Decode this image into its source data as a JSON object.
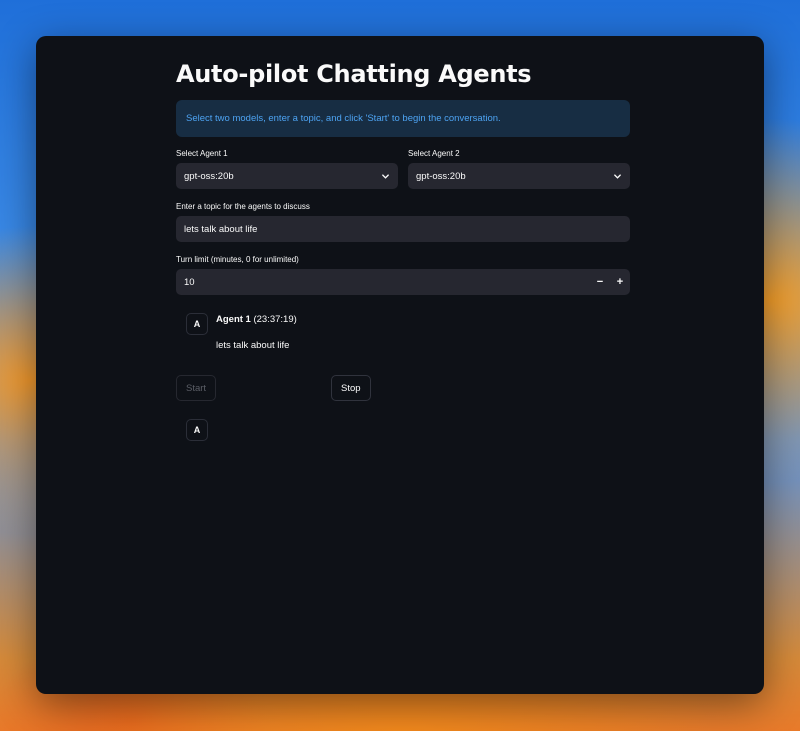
{
  "app": {
    "title": "Auto-pilot Chatting Agents",
    "info": "Select two models, enter a topic, and click 'Start' to begin the conversation."
  },
  "agent1": {
    "label": "Select Agent 1",
    "value": "gpt-oss:20b"
  },
  "agent2": {
    "label": "Select Agent 2",
    "value": "gpt-oss:20b"
  },
  "topic": {
    "label": "Enter a topic for the agents to discuss",
    "value": "lets talk about life"
  },
  "turn_limit": {
    "label": "Turn limit (minutes, 0 for unlimited)",
    "value": "10",
    "minus": "−",
    "plus": "+"
  },
  "messages": [
    {
      "avatar": "A",
      "author": "Agent 1",
      "time": "(23:37:19)",
      "text": "lets talk about life"
    }
  ],
  "buttons": {
    "start": "Start",
    "stop": "Stop"
  },
  "pending": {
    "avatar": "A"
  },
  "colors": {
    "background": "#0e1117",
    "input_bg": "#262730",
    "info_bg": "#172d43",
    "info_text": "#4da3f2"
  },
  "icons": {
    "select_chevron": "chevron-down-icon"
  }
}
